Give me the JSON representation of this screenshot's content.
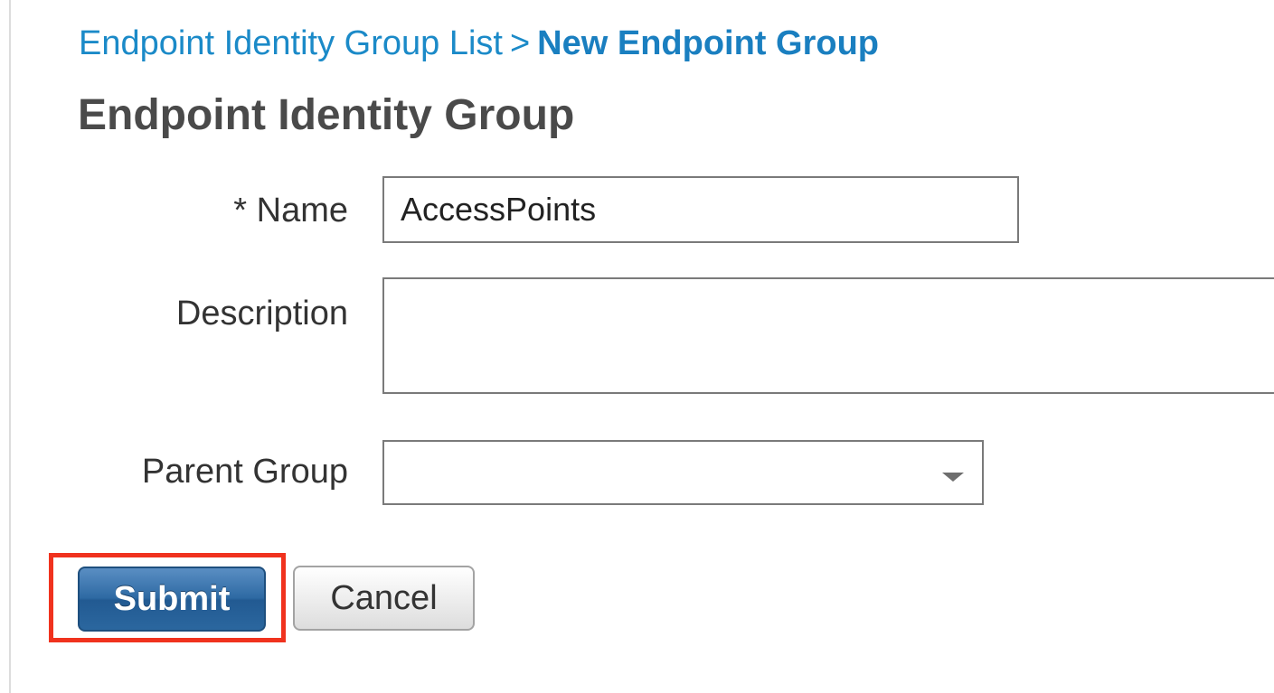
{
  "breadcrumb": {
    "parent": "Endpoint Identity Group List",
    "separator": ">",
    "current": "New Endpoint Group"
  },
  "page_title": "Endpoint Identity Group",
  "form": {
    "name": {
      "label": "* Name",
      "value": "AccessPoints"
    },
    "description": {
      "label": "Description",
      "value": ""
    },
    "parent_group": {
      "label": "Parent Group",
      "selected": "",
      "icon": "chevron-down-icon"
    }
  },
  "buttons": {
    "submit_label": "Submit",
    "cancel_label": "Cancel"
  },
  "colors": {
    "link": "#1b8ac8",
    "primary_button": "#2e6aa3",
    "highlight": "#f0321e"
  }
}
